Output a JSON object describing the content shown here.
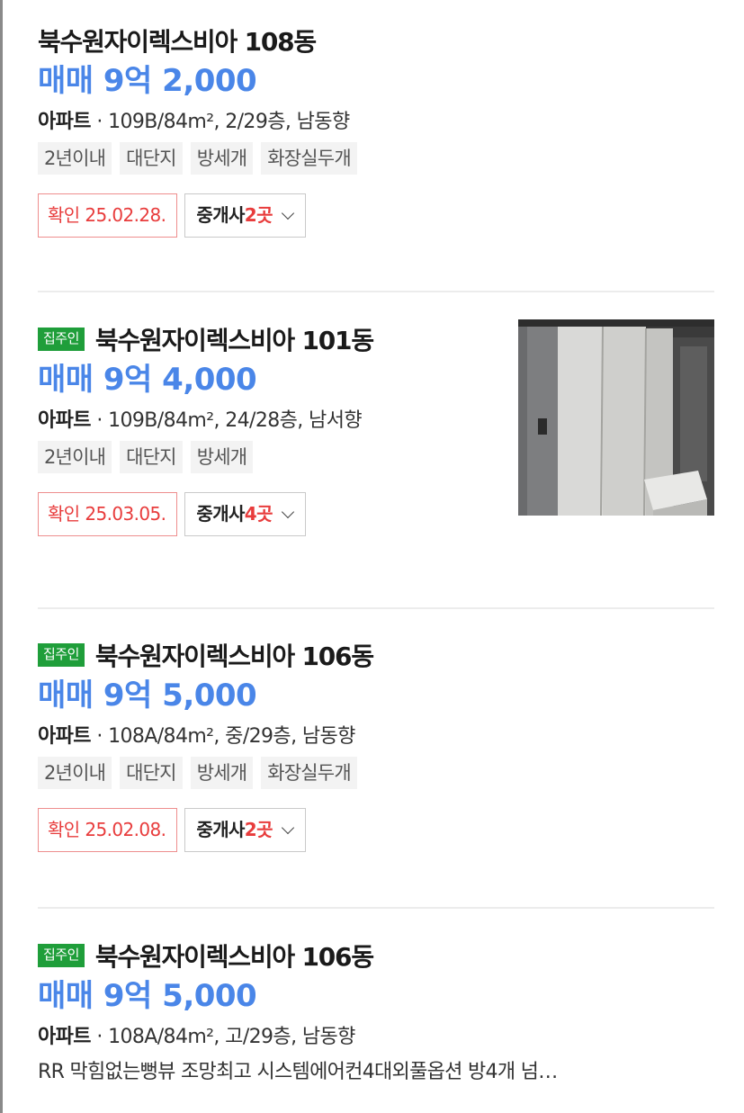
{
  "listings": [
    {
      "title": "북수원자이렉스비아 108동",
      "price": "매매 9억 2,000",
      "type": "아파트",
      "spec": " · 109B/84m², 2/29층, 남동향",
      "tags": [
        "2년이내",
        "대단지",
        "방세개",
        "화장실두개"
      ],
      "confirm": "확인 25.02.28.",
      "broker_label": "중개사 ",
      "broker_count": "2곳"
    },
    {
      "owner_badge": "집주인",
      "title": "북수원자이렉스비아 101동",
      "price": "매매 9억 4,000",
      "type": "아파트",
      "spec": " · 109B/84m², 24/28층, 남서향",
      "tags": [
        "2년이내",
        "대단지",
        "방세개"
      ],
      "confirm": "확인 25.03.05.",
      "broker_label": "중개사 ",
      "broker_count": "4곳"
    },
    {
      "owner_badge": "집주인",
      "title": "북수원자이렉스비아 106동",
      "price": "매매 9억 5,000",
      "type": "아파트",
      "spec": " · 108A/84m², 중/29층, 남동향",
      "tags": [
        "2년이내",
        "대단지",
        "방세개",
        "화장실두개"
      ],
      "confirm": "확인 25.02.08.",
      "broker_label": "중개사 ",
      "broker_count": "2곳"
    },
    {
      "owner_badge": "집주인",
      "title": "북수원자이렉스비아 106동",
      "price": "매매 9억 5,000",
      "type": "아파트",
      "spec": " · 108A/84m², 고/29층, 남동향",
      "description": "RR 막힘없는뻥뷰 조망최고 시스템에어컨4대외풀옵션 방4개 넘…"
    }
  ],
  "colors": {
    "price": "#4a86e8",
    "owner_badge": "#1f9e3a",
    "confirm": "#e83c3c"
  }
}
